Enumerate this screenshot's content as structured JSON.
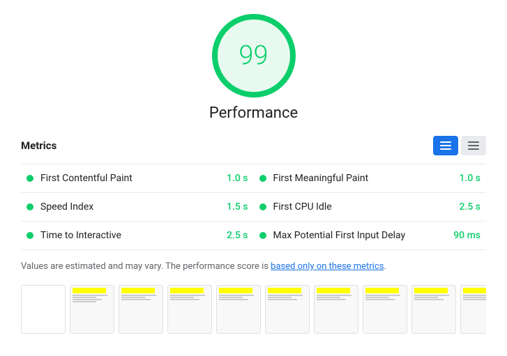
{
  "score": {
    "value": "99",
    "label": "Performance"
  },
  "metrics_header": {
    "title": "Metrics",
    "toggle_list_label": "List view",
    "toggle_grid_label": "Grid view"
  },
  "metrics": [
    {
      "name": "First Contentful Paint",
      "value": "1.0 s",
      "color": "#0cce6b"
    },
    {
      "name": "First Meaningful Paint",
      "value": "1.0 s",
      "color": "#0cce6b"
    },
    {
      "name": "Speed Index",
      "value": "1.5 s",
      "color": "#0cce6b"
    },
    {
      "name": "First CPU Idle",
      "value": "2.5 s",
      "color": "#0cce6b"
    },
    {
      "name": "Time to Interactive",
      "value": "2.5 s",
      "color": "#0cce6b"
    },
    {
      "name": "Max Potential First Input Delay",
      "value": "90 ms",
      "color": "#0cce6b"
    }
  ],
  "note": {
    "text_before": "Values are estimated and may vary. The performance score is ",
    "link_text": "based only on these metrics",
    "text_after": "."
  },
  "filmstrip": {
    "frames": [
      0,
      1,
      2,
      3,
      4,
      5,
      6,
      7,
      8,
      9
    ]
  }
}
